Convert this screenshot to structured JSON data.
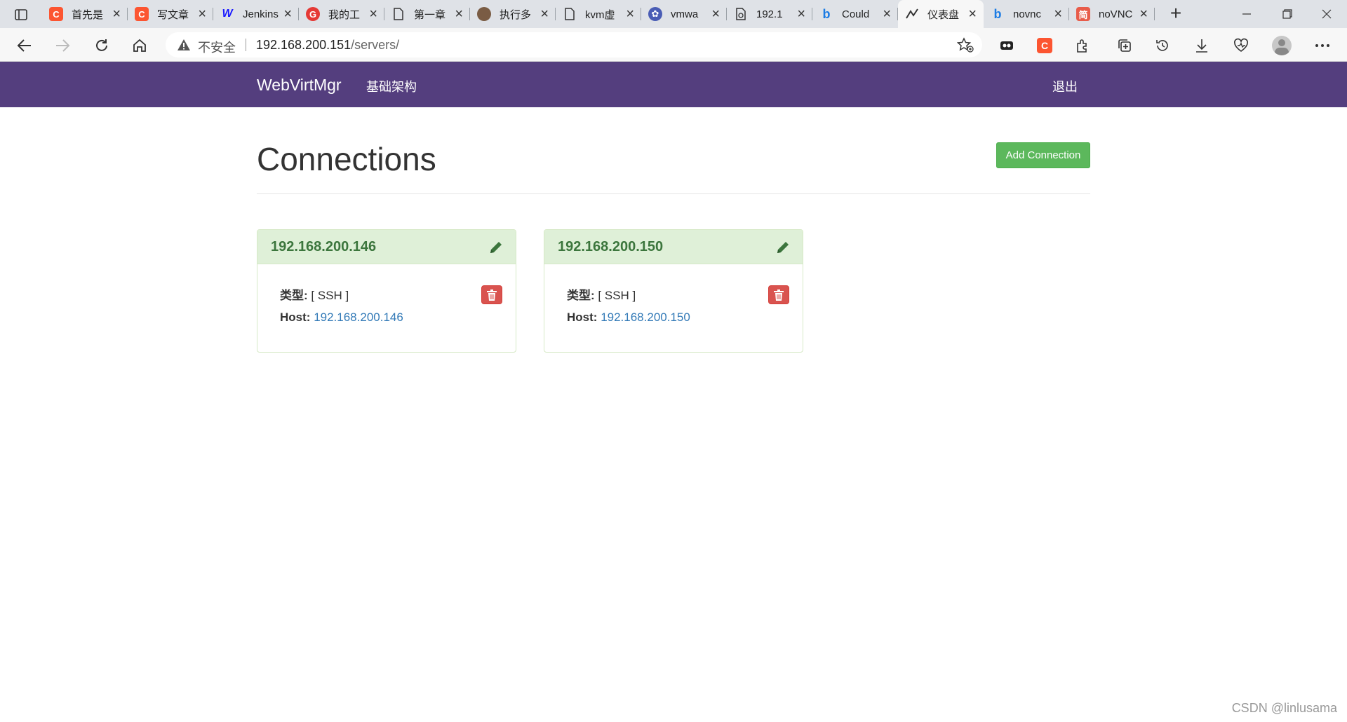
{
  "browser": {
    "tabs": [
      {
        "title": "首先是",
        "favicon_letter": "C",
        "favicon_color": "#fc5531"
      },
      {
        "title": "写文章",
        "favicon_letter": "C",
        "favicon_color": "#fc5531"
      },
      {
        "title": "Jenkins",
        "favicon_letter": "W",
        "favicon_color": "#1a1aff"
      },
      {
        "title": "我的工",
        "favicon_letter": "G",
        "favicon_color": "#e53935"
      },
      {
        "title": "第一章",
        "favicon_letter": "",
        "favicon_color": "#ffffff"
      },
      {
        "title": "执行多",
        "favicon_letter": "",
        "favicon_color": "#7a5c44"
      },
      {
        "title": "kvm虚",
        "favicon_letter": "",
        "favicon_color": "#ffffff"
      },
      {
        "title": "vmwa",
        "favicon_letter": "",
        "favicon_color": "#4a5db5"
      },
      {
        "title": "192.1",
        "favicon_letter": "",
        "favicon_color": "#ffffff"
      },
      {
        "title": "Could",
        "favicon_letter": "b",
        "favicon_color": "#1c7ce4"
      },
      {
        "title": "仪表盘",
        "favicon_letter": "",
        "favicon_color": "#333333",
        "active": true
      },
      {
        "title": "novnc",
        "favicon_letter": "b",
        "favicon_color": "#1c7ce4"
      },
      {
        "title": "noVNC",
        "favicon_letter": "简",
        "favicon_color": "#e85c4a"
      }
    ],
    "security_label": "不安全",
    "url_host": "192.168.200.151",
    "url_path": "/servers/"
  },
  "navbar": {
    "brand": "WebVirtMgr",
    "nav_link": "基础架构",
    "logout": "退出"
  },
  "page": {
    "title": "Connections",
    "add_button": "Add Connection"
  },
  "connections": [
    {
      "name": "192.168.200.146",
      "type_label": "类型:",
      "type_value": "[ SSH ]",
      "host_label": "Host:",
      "host_value": "192.168.200.146"
    },
    {
      "name": "192.168.200.150",
      "type_label": "类型:",
      "type_value": "[ SSH ]",
      "host_label": "Host:",
      "host_value": "192.168.200.150"
    }
  ],
  "watermark": "CSDN @linlusama",
  "colors": {
    "navbar": "#543e7e",
    "success": "#5cb85c",
    "panel_heading": "#dff0d8",
    "panel_text": "#3c763d",
    "danger": "#d9534f",
    "link": "#337ab7"
  }
}
